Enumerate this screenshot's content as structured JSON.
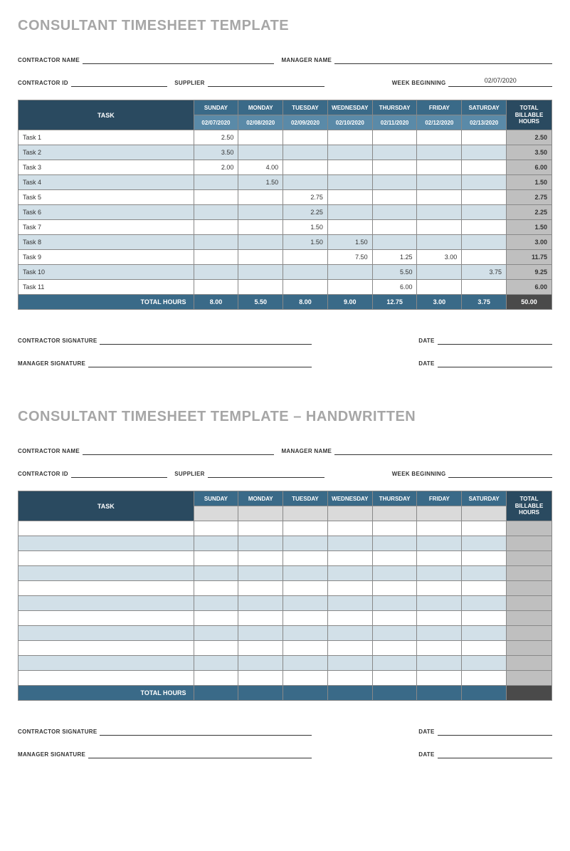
{
  "doc1": {
    "title": "CONSULTANT TIMESHEET TEMPLATE",
    "fields": {
      "contractor_name_label": "CONTRACTOR NAME",
      "manager_name_label": "MANAGER NAME",
      "contractor_id_label": "CONTRACTOR ID",
      "supplier_label": "SUPPLIER",
      "week_beginning_label": "WEEK BEGINNING",
      "week_beginning_value": "02/07/2020",
      "contractor_sig_label": "CONTRACTOR SIGNATURE",
      "manager_sig_label": "MANAGER SIGNATURE",
      "date_label": "DATE"
    },
    "headers": {
      "task": "TASK",
      "days": [
        "SUNDAY",
        "MONDAY",
        "TUESDAY",
        "WEDNESDAY",
        "THURSDAY",
        "FRIDAY",
        "SATURDAY"
      ],
      "dates": [
        "02/07/2020",
        "02/08/2020",
        "02/09/2020",
        "02/10/2020",
        "02/11/2020",
        "02/12/2020",
        "02/13/2020"
      ],
      "total": "TOTAL BILLABLE HOURS",
      "total_hours_label": "TOTAL HOURS"
    },
    "rows": [
      {
        "task": "Task 1",
        "vals": [
          "2.50",
          "",
          "",
          "",
          "",
          "",
          ""
        ],
        "total": "2.50"
      },
      {
        "task": "Task 2",
        "vals": [
          "3.50",
          "",
          "",
          "",
          "",
          "",
          ""
        ],
        "total": "3.50"
      },
      {
        "task": "Task 3",
        "vals": [
          "2.00",
          "4.00",
          "",
          "",
          "",
          "",
          ""
        ],
        "total": "6.00"
      },
      {
        "task": "Task 4",
        "vals": [
          "",
          "1.50",
          "",
          "",
          "",
          "",
          ""
        ],
        "total": "1.50"
      },
      {
        "task": "Task 5",
        "vals": [
          "",
          "",
          "2.75",
          "",
          "",
          "",
          ""
        ],
        "total": "2.75"
      },
      {
        "task": "Task 6",
        "vals": [
          "",
          "",
          "2.25",
          "",
          "",
          "",
          ""
        ],
        "total": "2.25"
      },
      {
        "task": "Task 7",
        "vals": [
          "",
          "",
          "1.50",
          "",
          "",
          "",
          ""
        ],
        "total": "1.50"
      },
      {
        "task": "Task 8",
        "vals": [
          "",
          "",
          "1.50",
          "1.50",
          "",
          "",
          ""
        ],
        "total": "3.00"
      },
      {
        "task": "Task 9",
        "vals": [
          "",
          "",
          "",
          "7.50",
          "1.25",
          "3.00",
          ""
        ],
        "total": "11.75"
      },
      {
        "task": "Task 10",
        "vals": [
          "",
          "",
          "",
          "",
          "5.50",
          "",
          "3.75"
        ],
        "total": "9.25"
      },
      {
        "task": "Task 11",
        "vals": [
          "",
          "",
          "",
          "",
          "6.00",
          "",
          ""
        ],
        "total": "6.00"
      }
    ],
    "totals": {
      "vals": [
        "8.00",
        "5.50",
        "8.00",
        "9.00",
        "12.75",
        "3.00",
        "3.75"
      ],
      "grand": "50.00"
    }
  },
  "doc2": {
    "title": "CONSULTANT TIMESHEET TEMPLATE – HANDWRITTEN",
    "fields": {
      "contractor_name_label": "CONTRACTOR NAME",
      "manager_name_label": "MANAGER NAME",
      "contractor_id_label": "CONTRACTOR ID",
      "supplier_label": "SUPPLIER",
      "week_beginning_label": "WEEK BEGINNING",
      "contractor_sig_label": "CONTRACTOR SIGNATURE",
      "manager_sig_label": "MANAGER SIGNATURE",
      "date_label": "DATE"
    },
    "headers": {
      "task": "TASK",
      "days": [
        "SUNDAY",
        "MONDAY",
        "TUESDAY",
        "WEDNESDAY",
        "THURSDAY",
        "FRIDAY",
        "SATURDAY"
      ],
      "total": "TOTAL BILLABLE HOURS",
      "total_hours_label": "TOTAL HOURS"
    },
    "blank_row_count": 11
  }
}
